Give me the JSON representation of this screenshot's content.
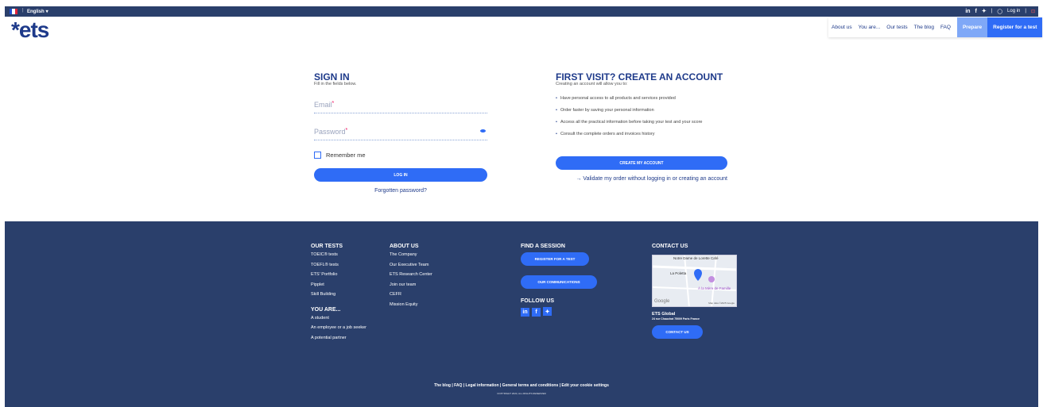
{
  "topbar": {
    "language": "English",
    "login": "Log in",
    "social": [
      "in",
      "f",
      "🐦"
    ]
  },
  "header": {
    "logo": "*ets",
    "nav": [
      "About us",
      "You are...",
      "Our tests",
      "The blog",
      "FAQ"
    ],
    "prepare": "Prepare",
    "register": "Register for a test"
  },
  "signin": {
    "title": "SIGN IN",
    "subtitle": "Fill in the fields below.",
    "email_label": "Email",
    "password_label": "Password",
    "remember": "Remember me",
    "login_button": "LOG IN",
    "forgot": "Forgotten password?"
  },
  "create": {
    "title": "FIRST VISIT? CREATE AN ACCOUNT",
    "subtitle": "Creating an account will allow you to:",
    "benefits": [
      "Have personal access to all products and services provided",
      "Order faster by saving your personal information",
      "Access all the practical information before taking your test and your score",
      "Consult the complete orders and invoices history"
    ],
    "button": "CREATE MY ACCOUNT",
    "validate": "→ Validate my order without logging in or creating an account"
  },
  "footer": {
    "tests_title": "OUR TESTS",
    "tests": [
      "TOEIC® tests",
      "TOEFL® tests",
      "ETS' Portfolio",
      "Pipplet",
      "Skill Building"
    ],
    "youare_title": "YOU ARE...",
    "youare": [
      "A student",
      "An employee or a job seeker",
      "A potential partner"
    ],
    "about_title": "ABOUT US",
    "about": [
      "The Company",
      "Our Executive Team",
      "ETS Research Center",
      "Join our team",
      "CEFR",
      "Mission Equity"
    ],
    "session_title": "FIND A SESSION",
    "session_btn": "REGISTER FOR A TEST",
    "comm_btn": "OUR COMMUNICATIONS",
    "follow_title": "FOLLOW US",
    "contact_title": "CONTACT US",
    "map_labels": [
      "Notre Dame de Lorette Café",
      "La Poletta",
      "À la Mère de Famille",
      "Google",
      "Map data ©2025 Google"
    ],
    "company": "ETS Global",
    "address": "24 rue Chauchat 75009 Paris France",
    "contact_btn": "CONTACT US",
    "links": "The blog   |   FAQ   |   Legal information   |   General terms and conditions   |   Edit your cookie settings",
    "copyright": "COPYRIGHT 2024, ALL RIGHTS RESERVED"
  },
  "colors": {
    "navy": "#2a3f6b",
    "accent": "#2f6cf6",
    "prepare": "#7fa8f7",
    "heading": "#1e3a8a"
  }
}
